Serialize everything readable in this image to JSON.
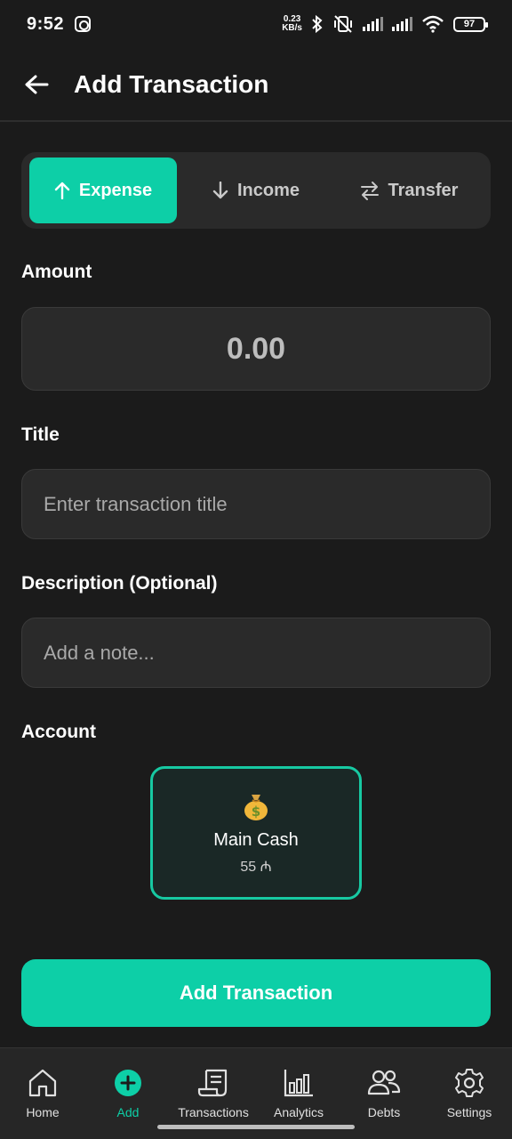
{
  "status_bar": {
    "time": "9:52",
    "net_speed_value": "0.23",
    "net_speed_unit": "KB/s",
    "battery": "97"
  },
  "header": {
    "title": "Add Transaction"
  },
  "type_tabs": [
    {
      "label": "Expense",
      "icon": "arrow-up-icon",
      "active": true
    },
    {
      "label": "Income",
      "icon": "arrow-down-icon",
      "active": false
    },
    {
      "label": "Transfer",
      "icon": "swap-arrows-icon",
      "active": false
    }
  ],
  "form": {
    "amount_label": "Amount",
    "amount_placeholder": "0.00",
    "title_label": "Title",
    "title_placeholder": "Enter transaction title",
    "description_label": "Description (Optional)",
    "description_placeholder": "Add a note...",
    "account_label": "Account"
  },
  "account": {
    "icon": "money-bag-icon",
    "name": "Main Cash",
    "balance": "55 ₼"
  },
  "submit_label": "Add Transaction",
  "bottom_nav": [
    {
      "label": "Home",
      "icon": "home-icon",
      "active": false
    },
    {
      "label": "Add",
      "icon": "add-circle-icon",
      "active": true
    },
    {
      "label": "Transactions",
      "icon": "receipt-icon",
      "active": false
    },
    {
      "label": "Analytics",
      "icon": "bar-chart-icon",
      "active": false
    },
    {
      "label": "Debts",
      "icon": "people-icon",
      "active": false
    },
    {
      "label": "Settings",
      "icon": "gear-icon",
      "active": false
    }
  ],
  "colors": {
    "accent": "#0dcfa7",
    "background": "#1b1b1b",
    "surface": "#2a2a2a"
  }
}
